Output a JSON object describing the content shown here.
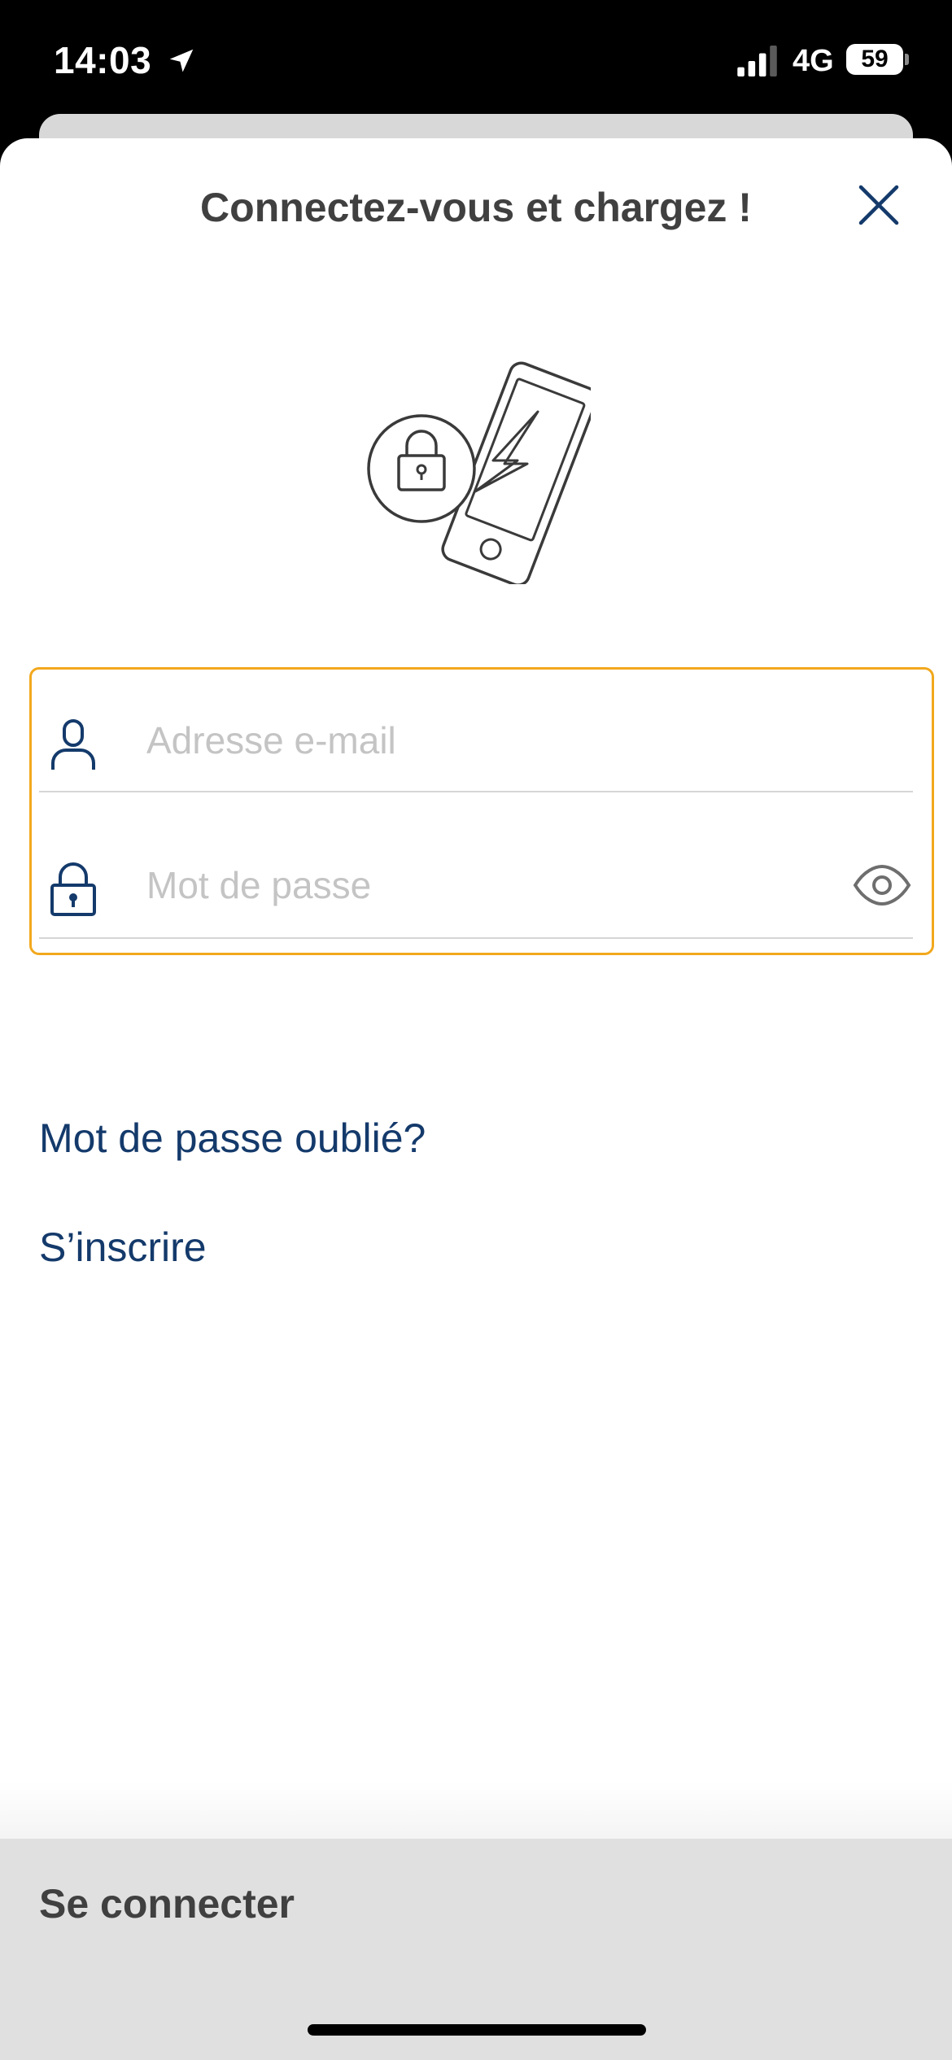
{
  "status_bar": {
    "time": "14:03",
    "network": "4G",
    "battery": "59",
    "icons": [
      "location-arrow-icon",
      "signal-icon"
    ]
  },
  "sheet": {
    "title": "Connectez-vous et chargez !",
    "close_icon": "close-icon",
    "illustration_icon": "phone-lock-charge-icon"
  },
  "form": {
    "email": {
      "placeholder": "Adresse e-mail",
      "value": "",
      "icon": "user-icon"
    },
    "password": {
      "placeholder": "Mot de passe",
      "value": "",
      "icon": "lock-icon",
      "toggle_icon": "eye-icon"
    },
    "focus_color": "#f2a81d"
  },
  "links": {
    "forgot_password": "Mot de passe oublié?",
    "signup": "S’inscrire",
    "color": "#143a6b"
  },
  "actions": {
    "login_label": "Se connecter"
  }
}
